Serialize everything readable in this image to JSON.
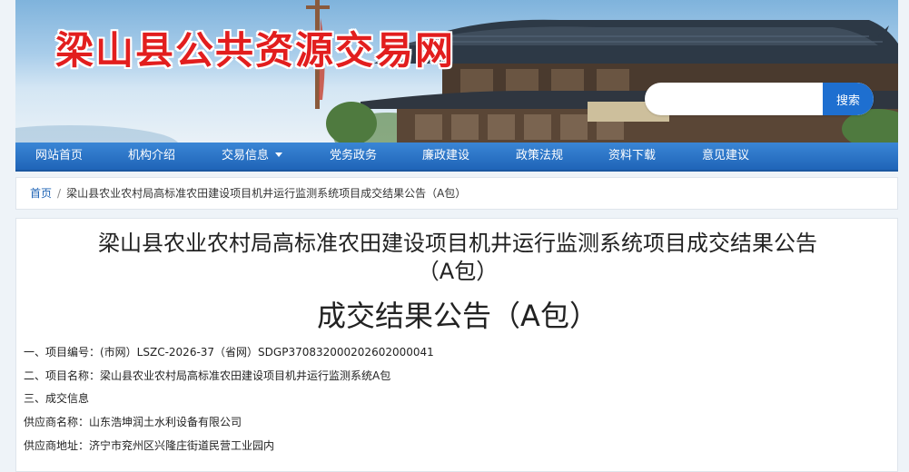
{
  "header": {
    "site_title": "梁山县公共资源交易网",
    "search": {
      "placeholder": "",
      "button_label": "搜索"
    }
  },
  "nav": {
    "items": [
      {
        "label": "网站首页"
      },
      {
        "label": "机构介绍"
      },
      {
        "label": "交易信息",
        "has_dropdown": true
      },
      {
        "label": "党务政务"
      },
      {
        "label": "廉政建设"
      },
      {
        "label": "政策法规"
      },
      {
        "label": "资料下载"
      },
      {
        "label": "意见建议"
      }
    ]
  },
  "breadcrumb": {
    "home": "首页",
    "separator": "/",
    "current": "梁山县农业农村局高标准农田建设项目机井运行监测系统项目成交结果公告（A包）"
  },
  "article": {
    "title_line1": "梁山县农业农村局高标准农田建设项目机井运行监测系统项目成交结果公告",
    "title_line2": "（A包）",
    "subtitle": "成交结果公告（A包）",
    "lines": [
      "一、项目编号：(市网）LSZC-2026-37（省网）SDGP370832000202602000041",
      "二、项目名称：梁山县农业农村局高标准农田建设项目机井运行监测系统A包",
      "三、成交信息",
      "供应商名称：山东浩坤润土水利设备有限公司",
      "供应商地址：济宁市兖州区兴隆庄街道民营工业园内"
    ]
  },
  "colors": {
    "title_red": "#e21e1e",
    "nav_blue": "#2a74c8",
    "link_blue": "#1e63b5",
    "search_button": "#1e6fd0"
  }
}
